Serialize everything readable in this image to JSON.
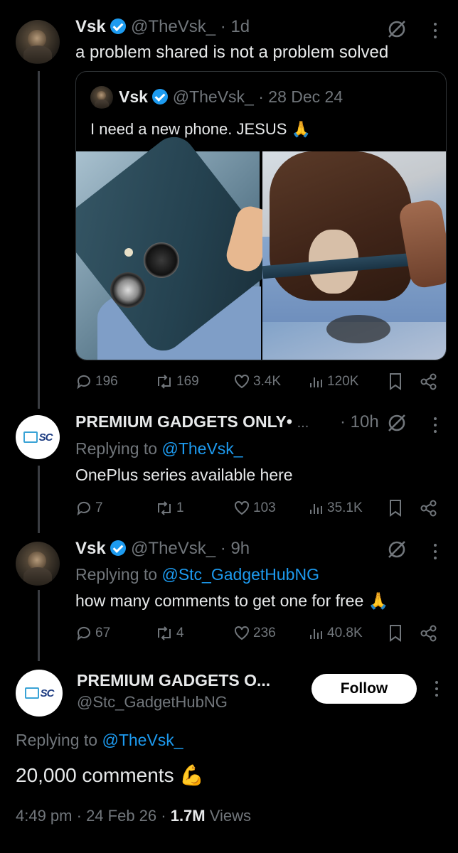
{
  "tweets": [
    {
      "name": "Vsk",
      "handle": "@TheVsk_",
      "time": "· 1d",
      "text": "a problem shared is not a problem solved",
      "quote": {
        "name": "Vsk",
        "handle": "@TheVsk_",
        "time": "· 28 Dec 24",
        "text": "I need a new phone. JESUS 🙏"
      },
      "stats": {
        "replies": "196",
        "reposts": "169",
        "likes": "3.4K",
        "views": "120K"
      }
    },
    {
      "name": "PREMIUM GADGETS ONLY•",
      "ellipsis": "...",
      "time": "· 10h",
      "replying_label": "Replying to",
      "replying_to": "@TheVsk_",
      "text": "OnePlus series available here",
      "stats": {
        "replies": "7",
        "reposts": "1",
        "likes": "103",
        "views": "35.1K"
      }
    },
    {
      "name": "Vsk",
      "handle": "@TheVsk_",
      "time": "· 9h",
      "replying_label": "Replying to",
      "replying_to": "@Stc_GadgetHubNG",
      "text": "how many comments to get one for free 🙏",
      "stats": {
        "replies": "67",
        "reposts": "4",
        "likes": "236",
        "views": "40.8K"
      }
    }
  ],
  "main": {
    "name": "PREMIUM GADGETS O...",
    "handle": "@Stc_GadgetHubNG",
    "follow_label": "Follow",
    "replying_label": "Replying to",
    "replying_to": "@TheVsk_",
    "text": "20,000 comments 💪",
    "time": "4:49 pm",
    "date": "· 24 Feb 26 ·",
    "views_count": "1.7M",
    "views_label": "Views"
  },
  "logo_text": "SC",
  "colors": {
    "accent": "#1d9bf0",
    "muted": "#71767b",
    "bg": "#000000",
    "text": "#e7e9ea"
  }
}
